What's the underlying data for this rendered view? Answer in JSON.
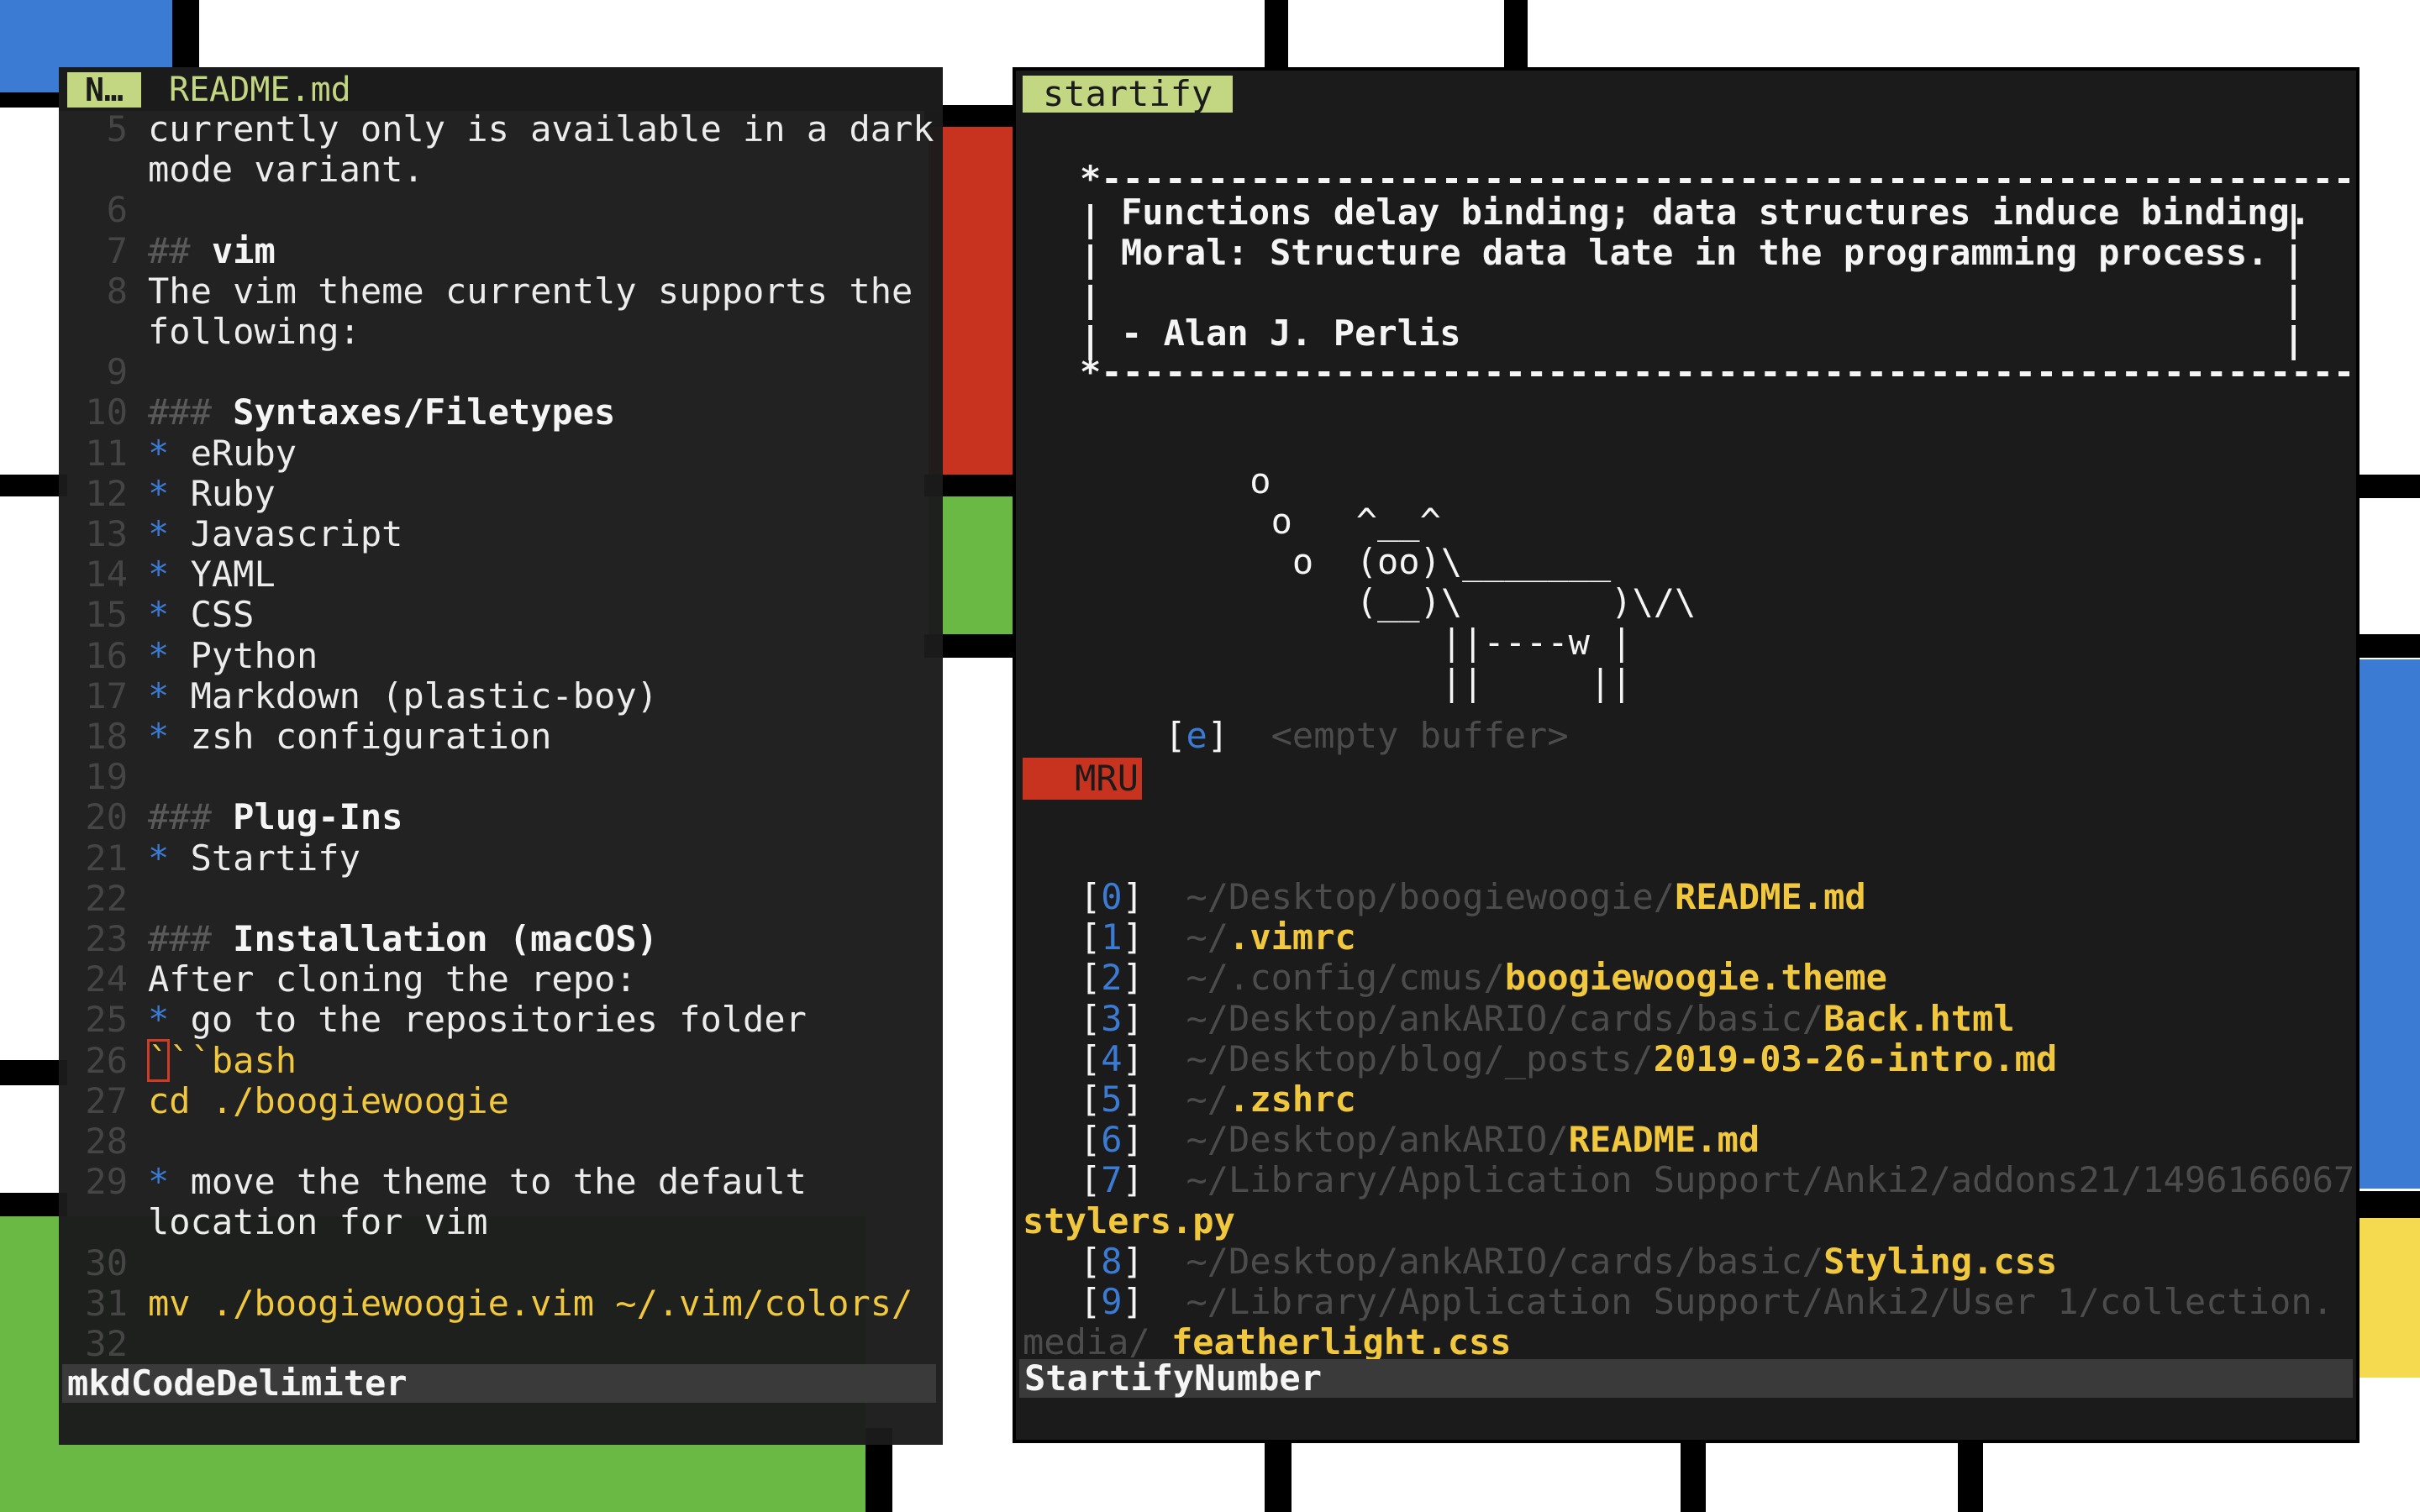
{
  "left_window": {
    "tab_mode": "N…",
    "tab_filename": "README.md",
    "lines": [
      {
        "n": "5",
        "text": "currently only is available in a dark",
        "kind": "plain"
      },
      {
        "n": "",
        "text": "mode variant.",
        "kind": "plain"
      },
      {
        "n": "6",
        "text": "",
        "kind": "plain"
      },
      {
        "n": "7",
        "prefix": "##",
        "text": "vim",
        "kind": "heading"
      },
      {
        "n": "8",
        "text": "The vim theme currently supports the",
        "kind": "plain"
      },
      {
        "n": "",
        "text": "following:",
        "kind": "plain"
      },
      {
        "n": "9",
        "text": "",
        "kind": "plain"
      },
      {
        "n": "10",
        "prefix": "###",
        "text": "Syntaxes/Filetypes",
        "kind": "heading"
      },
      {
        "n": "11",
        "bullet": "*",
        "text": "eRuby",
        "kind": "bullet"
      },
      {
        "n": "12",
        "bullet": "*",
        "text": "Ruby",
        "kind": "bullet"
      },
      {
        "n": "13",
        "bullet": "*",
        "text": "Javascript",
        "kind": "bullet"
      },
      {
        "n": "14",
        "bullet": "*",
        "text": "YAML",
        "kind": "bullet"
      },
      {
        "n": "15",
        "bullet": "*",
        "text": "CSS",
        "kind": "bullet"
      },
      {
        "n": "16",
        "bullet": "*",
        "text": "Python",
        "kind": "bullet"
      },
      {
        "n": "17",
        "bullet": "*",
        "text": "Markdown (plastic-boy)",
        "kind": "bullet"
      },
      {
        "n": "18",
        "bullet": "*",
        "text": "zsh configuration",
        "kind": "bullet"
      },
      {
        "n": "19",
        "text": "",
        "kind": "plain"
      },
      {
        "n": "20",
        "prefix": "###",
        "text": "Plug-Ins",
        "kind": "heading"
      },
      {
        "n": "21",
        "bullet": "*",
        "text": "Startify",
        "kind": "bullet"
      },
      {
        "n": "22",
        "text": "",
        "kind": "plain"
      },
      {
        "n": "23",
        "prefix": "###",
        "text": "Installation (macOS)",
        "kind": "heading"
      },
      {
        "n": "24",
        "text": "After cloning the repo:",
        "kind": "plain"
      },
      {
        "n": "25",
        "bullet": "*",
        "text": "go to the repositories folder",
        "kind": "bullet"
      },
      {
        "n": "26",
        "cursor_char": "`",
        "text": "``bash",
        "kind": "code"
      },
      {
        "n": "27",
        "text": "cd ./boogiewoogie",
        "kind": "code"
      },
      {
        "n": "28",
        "text": "",
        "kind": "plain"
      },
      {
        "n": "29",
        "bullet": "*",
        "text": "move the theme to the default",
        "kind": "bullet"
      },
      {
        "n": "",
        "text": "location for vim",
        "kind": "plain"
      },
      {
        "n": "30",
        "text": "",
        "kind": "plain"
      },
      {
        "n": "31",
        "text": "mv ./boogiewoogie.vim ~/.vim/colors/",
        "kind": "code"
      },
      {
        "n": "32",
        "text": "",
        "kind": "plain"
      }
    ],
    "status_text": "mkdCodeDelimiter"
  },
  "right_window": {
    "tab_label": "startify",
    "quote_border": "*-------------------------------------------------------------*",
    "quote_line1": "Functions delay binding; data structures induce binding.",
    "quote_line2": "Moral: Structure data late in the programming process.",
    "quote_author": "- Alan J. Perlis",
    "cow": [
      "        o",
      "         o   ^__^",
      "          o  (oo)\\_______",
      "             (__)\\       )\\/\\",
      "                 ||----w |",
      "                 ||     ||"
    ],
    "empty_key": "e",
    "empty_label": "<empty buffer>",
    "mru_label": "MRU",
    "mru_items": [
      {
        "index": "0",
        "path": "~/Desktop/boogiewoogie/",
        "file": "README.md"
      },
      {
        "index": "1",
        "path": "~/",
        "file": ".vimrc"
      },
      {
        "index": "2",
        "path": "~/.config/cmus/",
        "file": "boogiewoogie.theme"
      },
      {
        "index": "3",
        "path": "~/Desktop/ankARIO/cards/basic/",
        "file": "Back.html"
      },
      {
        "index": "4",
        "path": "~/Desktop/blog/_posts/",
        "file": "2019-03-26-intro.md"
      },
      {
        "index": "5",
        "path": "~/",
        "file": ".zshrc"
      },
      {
        "index": "6",
        "path": "~/Desktop/ankARIO/",
        "file": "README.md"
      },
      {
        "index": "7",
        "path": "~/Library/Application Support/Anki2/addons21/1496166067/",
        "file": "stylers.py"
      },
      {
        "index": "8",
        "path": "~/Desktop/ankARIO/cards/basic/",
        "file": "Styling.css"
      },
      {
        "index": "9",
        "path": "~/Library/Application Support/Anki2/User 1/collection.",
        "path2": "media/",
        "file": "_featherlight.css"
      }
    ],
    "status_text": "StartifyNumber"
  },
  "colors": {
    "blue": "#3b7bd4",
    "red": "#c8331f",
    "green": "#6ab945",
    "yellow": "#f5d94e",
    "bg": "#1b1b1b",
    "accent": "#c3d682",
    "file": "#f0c73d"
  }
}
